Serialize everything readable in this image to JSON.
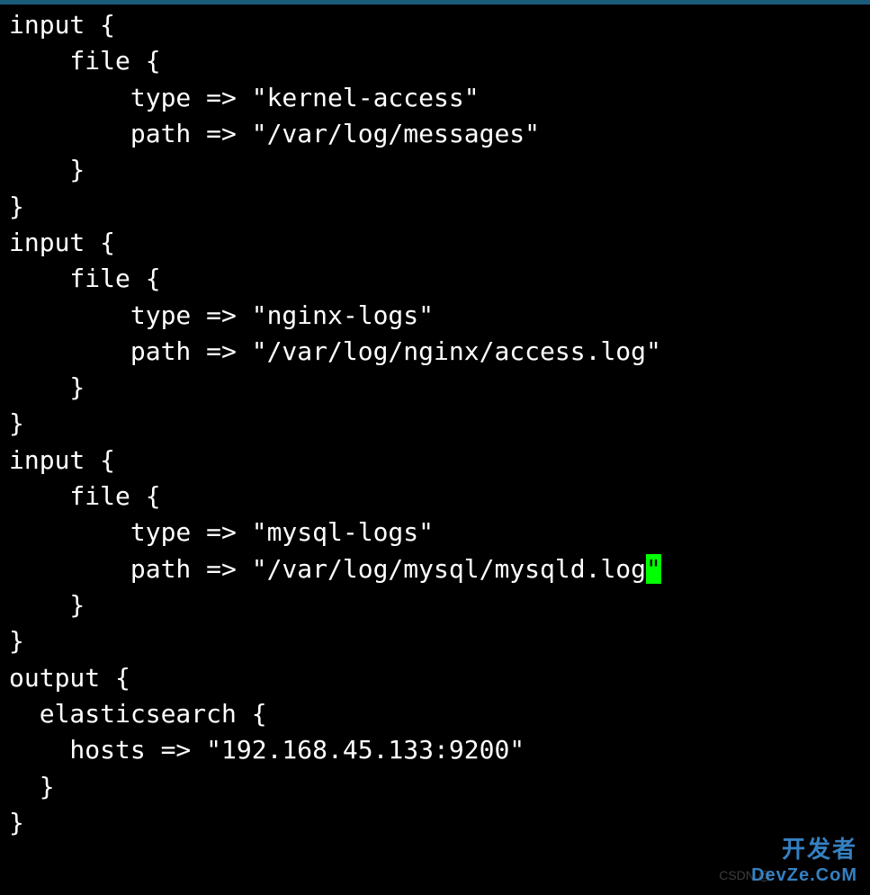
{
  "code": {
    "lines": [
      "input {",
      "    file {",
      "        type => \"kernel-access\"",
      "        path => \"/var/log/messages\"",
      "    }",
      "}",
      "input {",
      "    file {",
      "        type => \"nginx-logs\"",
      "        path => \"/var/log/nginx/access.log\"",
      "    }",
      "}",
      "input {",
      "    file {",
      "        type => \"mysql-logs\"",
      "        path => \"/var/log/mysql/mysqld.log\"",
      "    }",
      "}",
      "output {",
      "  elasticsearch {",
      "    hosts => \"192.168.45.133:9200\"",
      "  }",
      "}"
    ],
    "cursor": {
      "line": 15,
      "col": 42
    }
  },
  "watermark": {
    "cn": "开发者",
    "en": "DevZe.CoM",
    "csdn": "CSDN @"
  }
}
